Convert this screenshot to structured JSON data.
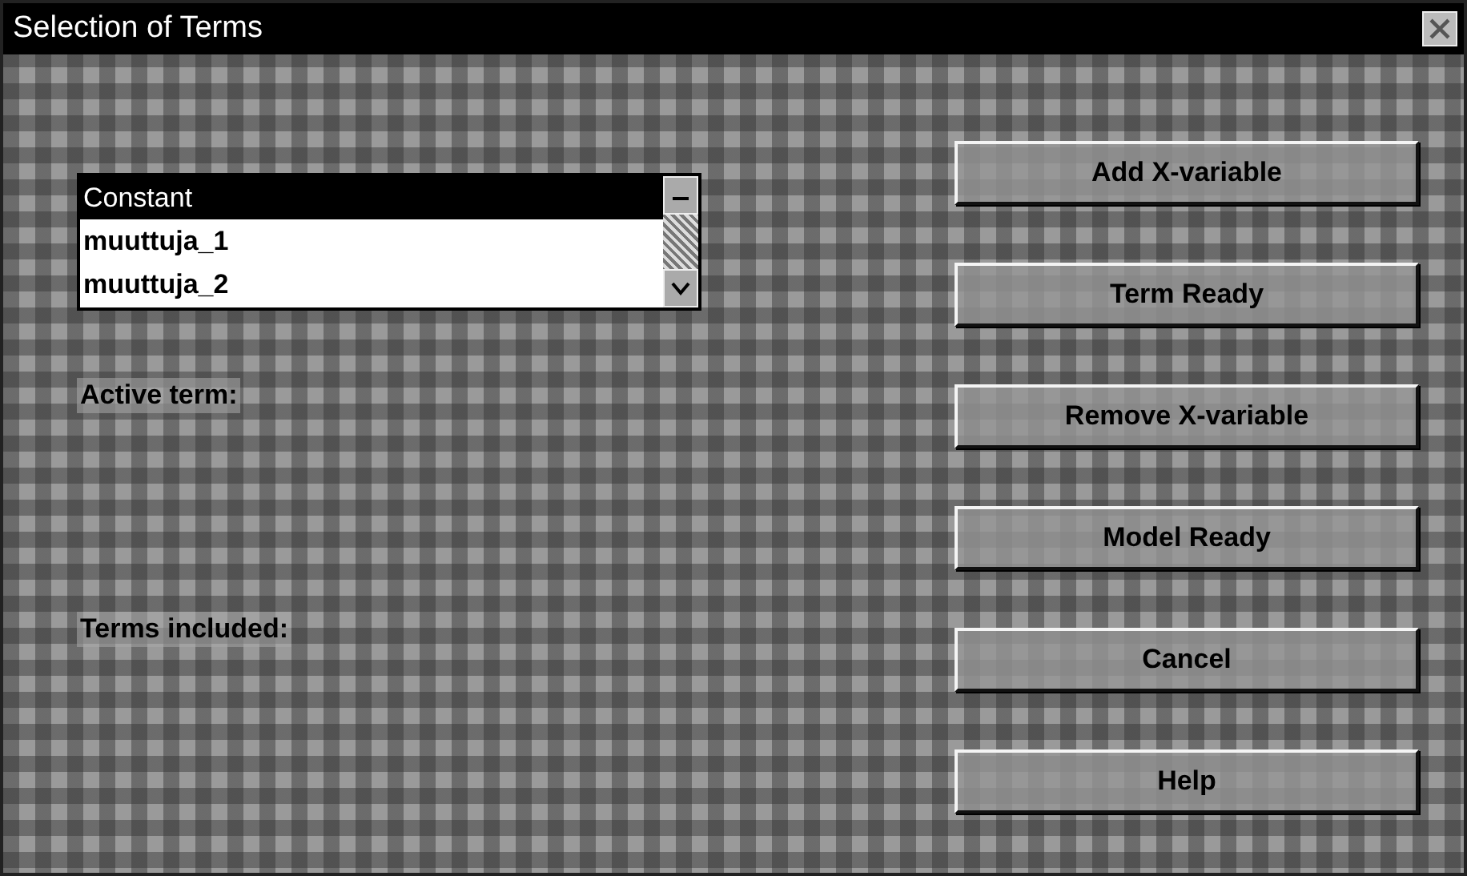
{
  "window": {
    "title": "Selection of Terms"
  },
  "variables": [
    {
      "label": "Constant",
      "selected": true
    },
    {
      "label": "muuttuja_1",
      "selected": false
    },
    {
      "label": "muuttuja_2",
      "selected": false
    }
  ],
  "labels": [
    {
      "text": "Active term:"
    },
    {
      "text": "Terms included:"
    }
  ],
  "buttons": [
    "Add X-variable",
    "Term Ready",
    "Remove X-variable",
    "Model Ready",
    "Cancel",
    "Help"
  ]
}
